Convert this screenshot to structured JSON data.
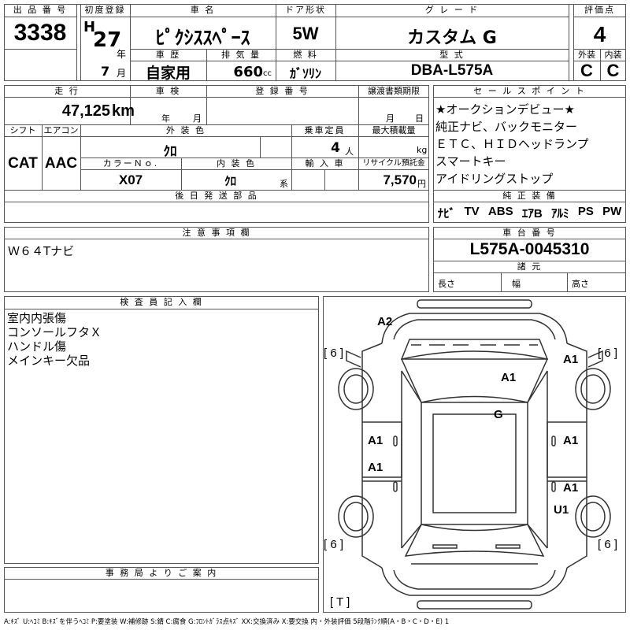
{
  "header": {
    "lot_label": "出 品 番 号",
    "lot_no": "3338",
    "first_reg_label": "初度登録",
    "era": "H",
    "year": "27",
    "year_unit": "年",
    "month": "7",
    "month_unit": "月",
    "car_name_label": "車 名",
    "car_name": "ﾋﾟｸｼｽｽﾍﾟｰｽ",
    "door_label": "ドア形状",
    "door": "5W",
    "grade_label": "グ レ ー ド",
    "grade": "カスタム G",
    "score_label": "評価点",
    "score": "4",
    "history_label": "車 歴",
    "history": "自家用",
    "disp_label": "排 気 量",
    "disp": "660",
    "disp_unit": "cc",
    "fuel_label": "燃 料",
    "fuel": "ｶﾞｿﾘﾝ",
    "model_label": "型 式",
    "model": "DBA-L575A",
    "ext_label": "外装",
    "ext": "C",
    "int_label": "内装",
    "int": "C"
  },
  "row2": {
    "mileage_label": "走 行",
    "mileage": "47,125",
    "mileage_unit": "km",
    "inspection_label": "車 検",
    "insp_year": "年",
    "insp_month": "月",
    "reg_label": "登 録 番 号",
    "deadline_label": "譲渡書類期限",
    "dl_month": "月",
    "dl_day": "日",
    "shift_label": "シフト",
    "shift": "CAT",
    "ac_label": "エアコン",
    "ac": "AAC",
    "color_label": "外 装 色",
    "color": "ｸﾛ",
    "capacity_label": "乗車定員",
    "capacity": "4",
    "capacity_unit": "人",
    "load_label": "最大積載量",
    "load_unit": "kg",
    "color_no_label": "カラーＮｏ.",
    "color_no": "X07",
    "int_color_label": "内 装 色",
    "int_color": "ｸﾛ",
    "int_color_unit": "系",
    "import_label": "輸 入 車",
    "recycle_label": "リサイクル預託金",
    "recycle": "7,570",
    "recycle_unit": "円",
    "later_label": "後 日 発 送 部 品"
  },
  "selling": {
    "label": "セ ー ル ス ポ イ ン ト",
    "lines": [
      "★オークションデビュー★",
      "純正ナビ、バックモニター",
      "ＥＴＣ、ＨＩＤヘッドランプ",
      "スマートキー",
      "アイドリングストップ"
    ]
  },
  "equipment": {
    "label": "純 正 装 備",
    "items": [
      "ﾅﾋﾞ",
      "TV",
      "ABS",
      "ｴｱB",
      "ｱﾙﾐ",
      "PS",
      "PW"
    ]
  },
  "notes": {
    "label": "注 意 事 項 欄",
    "text": "Ｗ６４Tナビ"
  },
  "chassis": {
    "label": "車 台 番 号",
    "number": "L575A-0045310",
    "dims_label": "諸 元",
    "length": "長さ",
    "width": "幅",
    "height": "高さ"
  },
  "inspector": {
    "label": "検 査 員 記 入 欄",
    "lines": [
      "室内内張傷",
      "コンソールフタＸ",
      "ハンドル傷",
      "メインキー欠品"
    ]
  },
  "office": {
    "label": "事 務 局 よ り ご 案 内"
  },
  "diagram": {
    "marks": {
      "a2": "A2",
      "a1_fr": "A1",
      "a1_roof": "A1",
      "g": "G",
      "a1_l1": "A1",
      "a1_r1": "A1",
      "a1_l2": "A1",
      "a1_r2": "A1",
      "u1": "U1",
      "tire": "[ 6 ]",
      "spare": "[ T ]"
    }
  },
  "legend": "A:ｷｽﾞ U:ﾍｺﾐ B:ｷｽﾞを伴うﾍｺﾐ P:要塗装 W:補修跡 S:錆 C:腐食 G:ﾌﾛﾝﾄｶﾞﾗｽ点ｷｽﾞ XX:交換済み X:要交換 内・外装評価 5段階ﾗﾝｸ順(A・B・C・D・E) 1"
}
